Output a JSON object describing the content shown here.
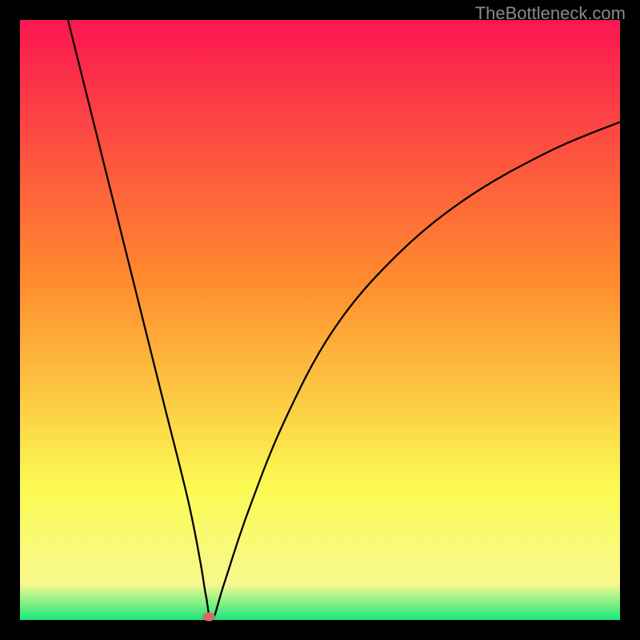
{
  "watermark": "TheBottleneck.com",
  "chart_data": {
    "type": "line",
    "title": "",
    "xlabel": "",
    "ylabel": "",
    "xlim": [
      0,
      100
    ],
    "ylim": [
      0,
      100
    ],
    "gradient_colors": {
      "top": "#fc1651",
      "upper_mid": "#fe8d2e",
      "lower_mid": "#fbfa53",
      "bottom": "#19e77c"
    },
    "series": [
      {
        "name": "bottleneck-curve",
        "x": [
          8,
          12,
          16,
          20,
          24,
          28,
          30,
          31,
          32,
          34,
          38,
          44,
          52,
          62,
          74,
          88,
          100
        ],
        "values": [
          100,
          84,
          68,
          52,
          36,
          20,
          10,
          4,
          0,
          6,
          18,
          33,
          48,
          60,
          70,
          78,
          83
        ]
      }
    ],
    "marker": {
      "x": 31.5,
      "y": 0.5,
      "color": "#d46a6a"
    },
    "grid": false,
    "legend": false
  }
}
